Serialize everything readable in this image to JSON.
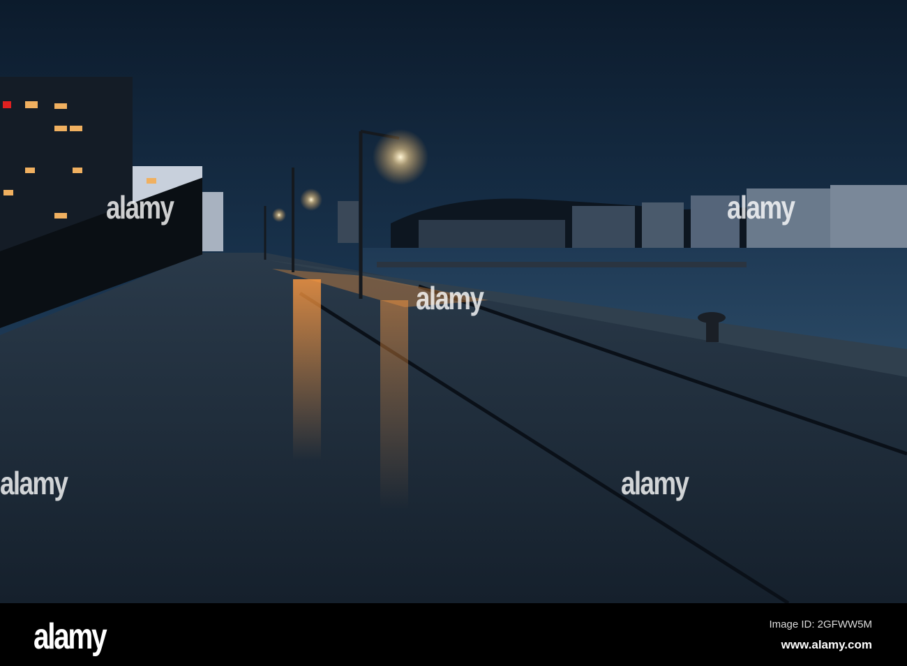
{
  "watermark": {
    "text": "alamy"
  },
  "footer": {
    "logo": "alamy",
    "image_id": "Image ID: 2GFWW5M",
    "url": "www.alamy.com"
  }
}
